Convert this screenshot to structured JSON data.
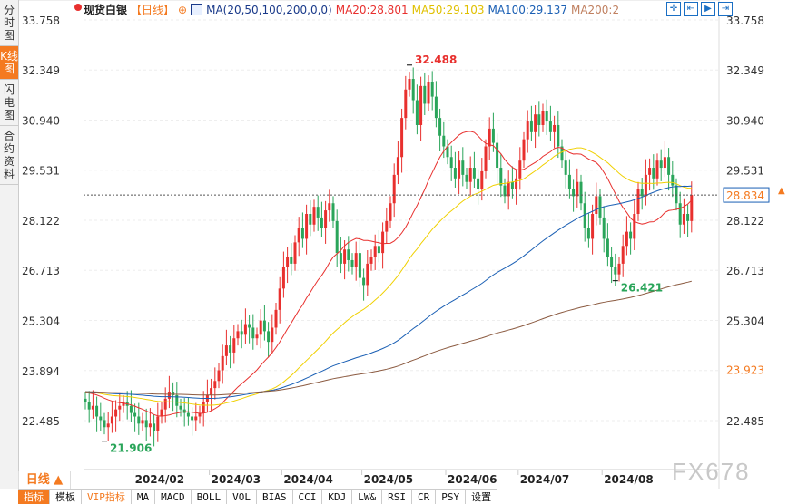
{
  "sidebar": {
    "tabs": [
      {
        "label": "分时图",
        "active": false
      },
      {
        "label": "K线图",
        "active": true
      },
      {
        "label": "闪电图",
        "active": false
      },
      {
        "label": "合约资料",
        "active": false
      }
    ]
  },
  "legend": {
    "name": "现货白银",
    "period": "【日线】",
    "ma_params": "MA(20,50,100,200,0,0)",
    "ma20": "MA20:28.801",
    "ma50": "MA50:29.103",
    "ma100": "MA100:29.137",
    "ma200": "MA200:2"
  },
  "toolbar": {
    "icons": [
      "crosshair-icon",
      "zoom-in-icon",
      "zoom-out-icon",
      "move-right-icon"
    ]
  },
  "period_selector": {
    "label": "日线 ▲"
  },
  "bottom_tabs": [
    "指标",
    "模板",
    "VIP指标",
    "MA",
    "MACD",
    "BOLL",
    "VOL",
    "BIAS",
    "CCI",
    "KDJ",
    "LW&",
    "RSI",
    "CR",
    "PSY",
    "设置"
  ],
  "watermark": "FX678",
  "colors": {
    "up": "#e8302e",
    "down": "#2aa55a",
    "ma20": "#e8302e",
    "ma50": "#f0d000",
    "ma100": "#1a5fb4",
    "ma200": "#8b5a40",
    "accent": "#f47a20"
  },
  "chart_data": {
    "type": "candlestick",
    "title": "现货白银 日线",
    "ylim": [
      22.485,
      33.758
    ],
    "y_ticks": [
      "33.758",
      "32.349",
      "30.940",
      "29.531",
      "28.122",
      "26.713",
      "25.304",
      "23.894",
      "22.485"
    ],
    "x_ticks": [
      {
        "label": "2024/02",
        "index": 13
      },
      {
        "label": "2024/03",
        "index": 33
      },
      {
        "label": "2024/04",
        "index": 52
      },
      {
        "label": "2024/05",
        "index": 73
      },
      {
        "label": "2024/06",
        "index": 95
      },
      {
        "label": "2024/07",
        "index": 114
      },
      {
        "label": "2024/08",
        "index": 136
      }
    ],
    "closes": [
      23.0,
      22.8,
      22.9,
      22.6,
      22.5,
      22.3,
      22.4,
      22.6,
      22.8,
      22.9,
      23.0,
      22.9,
      22.7,
      22.6,
      22.4,
      22.5,
      22.3,
      22.4,
      22.2,
      22.6,
      22.8,
      23.1,
      23.3,
      23.2,
      22.9,
      22.8,
      22.7,
      22.6,
      22.5,
      22.6,
      22.7,
      23.0,
      23.2,
      23.4,
      23.6,
      23.9,
      24.3,
      24.6,
      24.4,
      24.8,
      25.0,
      24.9,
      25.2,
      25.1,
      24.8,
      24.9,
      25.3,
      25.0,
      24.7,
      25.1,
      25.6,
      26.2,
      26.8,
      27.1,
      26.9,
      27.5,
      27.9,
      27.6,
      28.3,
      28.0,
      28.5,
      28.2,
      27.9,
      28.4,
      28.6,
      28.1,
      27.2,
      26.9,
      27.3,
      27.0,
      26.8,
      27.2,
      26.5,
      26.3,
      26.9,
      27.1,
      27.4,
      27.2,
      27.8,
      28.1,
      28.6,
      29.4,
      29.9,
      31.0,
      31.8,
      32.1,
      31.5,
      30.8,
      31.9,
      31.4,
      32.0,
      31.6,
      31.0,
      30.5,
      30.2,
      29.9,
      29.6,
      29.3,
      29.8,
      29.4,
      29.2,
      29.6,
      29.3,
      29.0,
      29.5,
      30.2,
      30.7,
      30.3,
      29.6,
      29.1,
      28.8,
      29.2,
      29.0,
      29.3,
      29.8,
      30.4,
      30.9,
      30.6,
      31.1,
      30.8,
      31.2,
      30.9,
      30.6,
      30.8,
      30.2,
      29.8,
      29.4,
      29.0,
      28.8,
      29.2,
      28.6,
      27.9,
      27.6,
      28.3,
      28.8,
      28.2,
      27.6,
      27.1,
      26.8,
      26.6,
      26.9,
      27.4,
      27.8,
      27.6,
      28.3,
      29.0,
      28.8,
      29.4,
      29.6,
      29.3,
      29.8,
      29.6,
      29.9,
      29.4,
      29.1,
      28.6,
      28.0,
      28.3,
      28.1,
      28.834
    ],
    "annotations": [
      {
        "label": "32.488",
        "value": 32.488,
        "index": 85,
        "color": "#e8302e"
      },
      {
        "label": "26.421",
        "value": 26.421,
        "index": 139,
        "color": "#2aa55a"
      },
      {
        "label": "21.906",
        "value": 21.906,
        "index": 5,
        "color": "#2aa55a"
      }
    ],
    "last_price": {
      "label": "28.834",
      "value": 28.834
    },
    "marker_price": {
      "label": "23.923",
      "value": 23.923
    }
  }
}
